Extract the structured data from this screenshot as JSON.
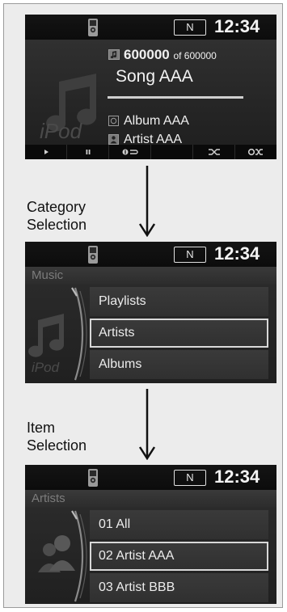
{
  "status_bar": {
    "gear": "N",
    "time": "12:34"
  },
  "now_playing": {
    "track_number": "600000",
    "track_of": "of 600000",
    "song": "Song AAA",
    "album": "Album AAA",
    "artist": "Artist AAA",
    "source_watermark": "iPod",
    "progress": 1.0,
    "controls": [
      "play",
      "pause",
      "repeat",
      "shuffle",
      "shuffle-all"
    ]
  },
  "step_labels": {
    "category": [
      "Category",
      "Selection"
    ],
    "item": [
      "Item",
      "Selection"
    ]
  },
  "category_screen": {
    "header": "Music",
    "source_watermark": "iPod",
    "items": [
      "Playlists",
      "Artists",
      "Albums"
    ],
    "selected_index": 1
  },
  "item_screen": {
    "header": "Artists",
    "items": [
      "01 All",
      "02 Artist AAA",
      "03 Artist BBB"
    ],
    "selected_index": 1
  },
  "colors": {
    "screen_bg": "#1a1a1a",
    "text": "#ececec",
    "selection_border": "#d8d8d8"
  }
}
